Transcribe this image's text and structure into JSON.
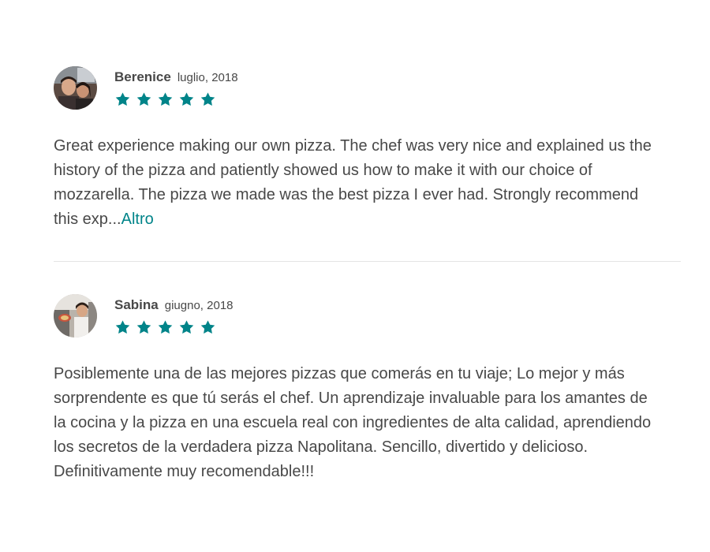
{
  "reviews": [
    {
      "name": "Berenice",
      "date": "luglio, 2018",
      "rating": 5,
      "text": "Great experience making our own pizza. The chef was very nice and explained us the history of the pizza and patiently showed us how to make it with our choice of mozzarella. The pizza we made was the best pizza I ever had. Strongly recommend this exp...",
      "more_label": "Altro"
    },
    {
      "name": "Sabina",
      "date": "giugno, 2018",
      "rating": 5,
      "text": "Posiblemente una de las mejores pizzas que comerás en tu viaje; Lo mejor y más sorprendente es que tú serás el chef. Un aprendizaje invaluable para los amantes de la cocina y la pizza en una escuela real con ingredientes de alta calidad, aprendiendo los secretos de la verdadera pizza Napolitana. Sencillo, divertido y delicioso. Definitivamente muy recomendable!!!"
    }
  ],
  "colors": {
    "accent": "#008489",
    "text": "#484848",
    "divider": "#e4e4e4"
  },
  "icons": {
    "star": "star-icon",
    "avatar": "avatar"
  }
}
